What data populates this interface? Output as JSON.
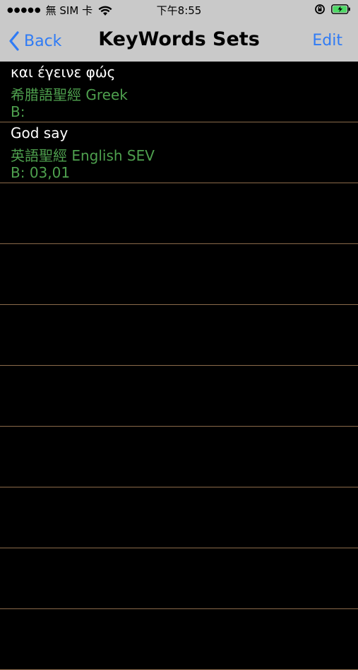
{
  "status_bar": {
    "carrier": "無 SIM 卡",
    "time": "下午8:55"
  },
  "nav": {
    "back_label": "Back",
    "title": "KeyWords Sets",
    "edit_label": "Edit"
  },
  "colors": {
    "accent": "#2f7bf5",
    "secondary_text": "#4ea04e",
    "divider": "#8a6a4a"
  },
  "rows": [
    {
      "keywords": "και έγεινε φώς",
      "bible": "希腊語聖經 Greek",
      "bookmark": "B:"
    },
    {
      "keywords": "God say",
      "bible": "英語聖經 English SEV",
      "bookmark": "B: 03,01"
    },
    {
      "keywords": "",
      "bible": "",
      "bookmark": ""
    },
    {
      "keywords": "",
      "bible": "",
      "bookmark": ""
    },
    {
      "keywords": "",
      "bible": "",
      "bookmark": ""
    },
    {
      "keywords": "",
      "bible": "",
      "bookmark": ""
    },
    {
      "keywords": "",
      "bible": "",
      "bookmark": ""
    },
    {
      "keywords": "",
      "bible": "",
      "bookmark": ""
    },
    {
      "keywords": "",
      "bible": "",
      "bookmark": ""
    },
    {
      "keywords": "",
      "bible": "",
      "bookmark": ""
    }
  ]
}
